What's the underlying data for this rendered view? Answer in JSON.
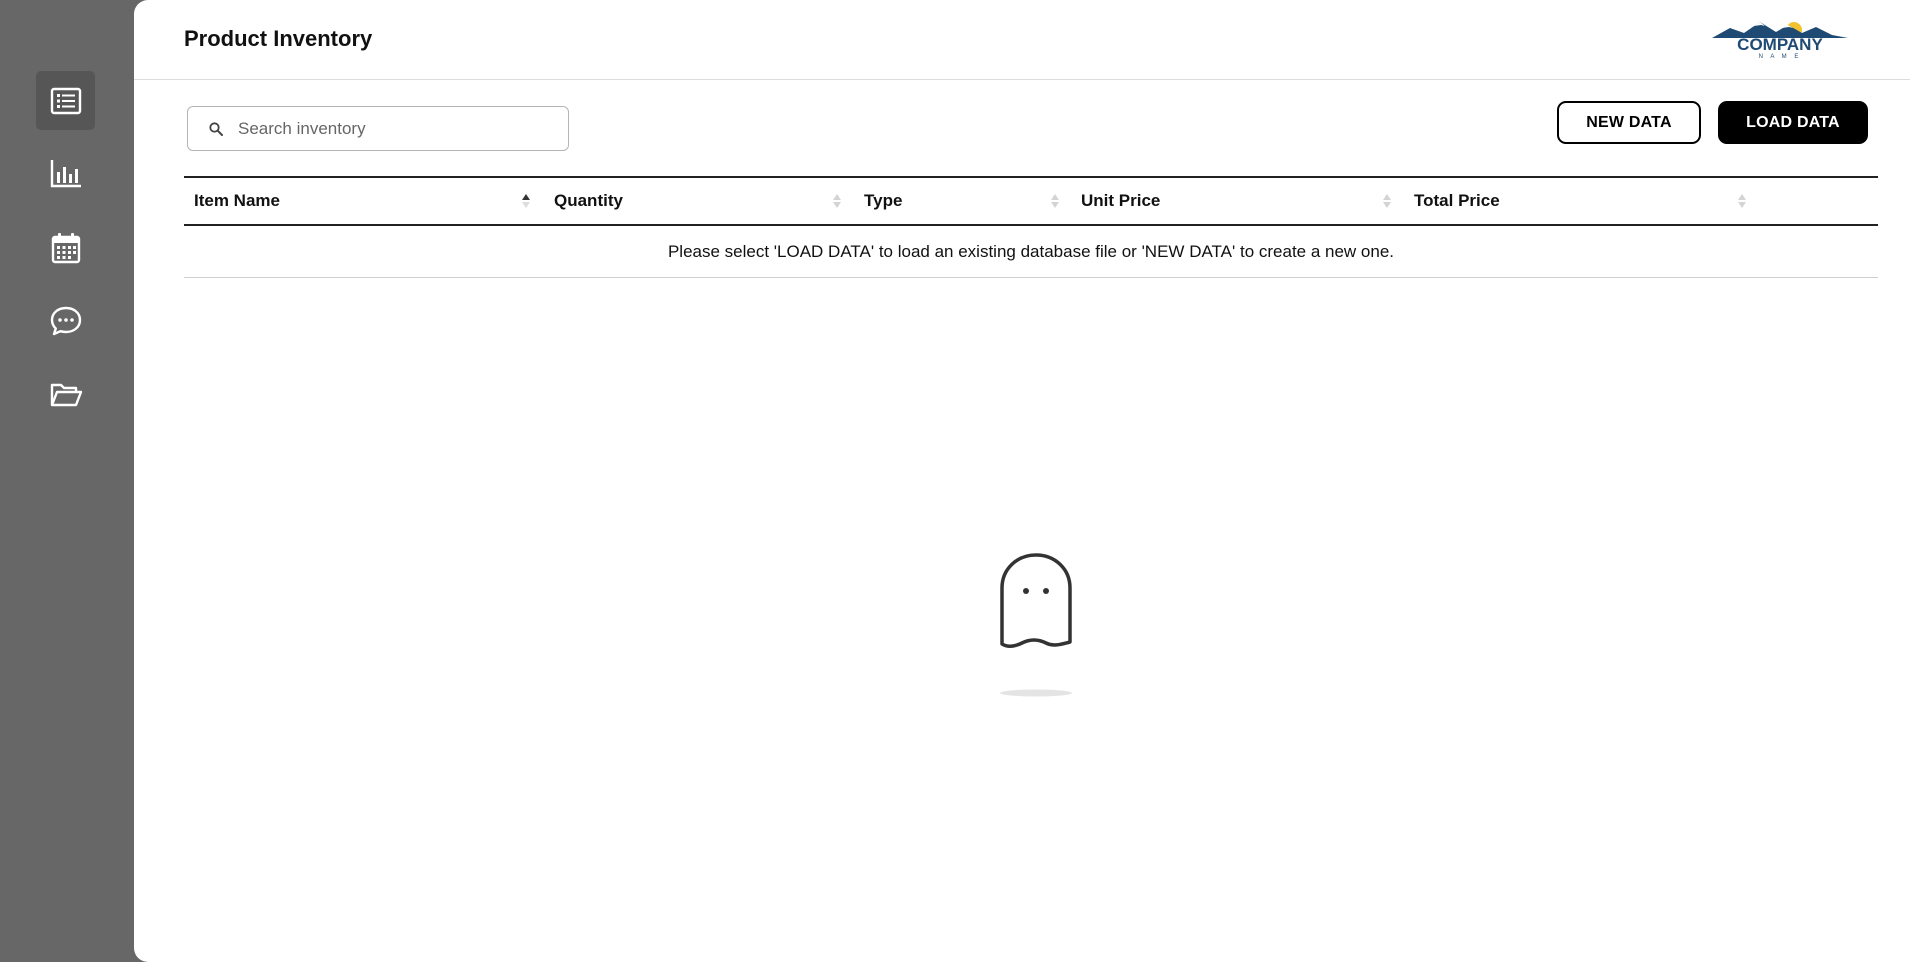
{
  "sidebar": {
    "items": [
      {
        "icon": "list-icon",
        "active": true
      },
      {
        "icon": "bar-chart-icon",
        "active": false
      },
      {
        "icon": "calendar-icon",
        "active": false
      },
      {
        "icon": "chat-icon",
        "active": false
      },
      {
        "icon": "folder-open-icon",
        "active": false
      }
    ]
  },
  "header": {
    "title": "Product Inventory",
    "logo": {
      "text": "COMPANY",
      "subtext": "N A M E"
    }
  },
  "search": {
    "placeholder": "Search inventory",
    "value": ""
  },
  "toolbar": {
    "new_label": "NEW DATA",
    "load_label": "LOAD DATA"
  },
  "table": {
    "columns": [
      {
        "label": "Item Name",
        "sort": "asc"
      },
      {
        "label": "Quantity",
        "sort": "none"
      },
      {
        "label": "Type",
        "sort": "none"
      },
      {
        "label": "Unit Price",
        "sort": "none"
      },
      {
        "label": "Total Price",
        "sort": "none"
      }
    ],
    "empty_message": "Please select 'LOAD DATA' to load an existing database file or 'NEW DATA' to create a new one."
  },
  "colors": {
    "sidebar_bg": "#676767",
    "active_item": "#565656",
    "primary": "#000000",
    "logo_blue": "#1f4a73",
    "logo_sun": "#f2c12e"
  }
}
